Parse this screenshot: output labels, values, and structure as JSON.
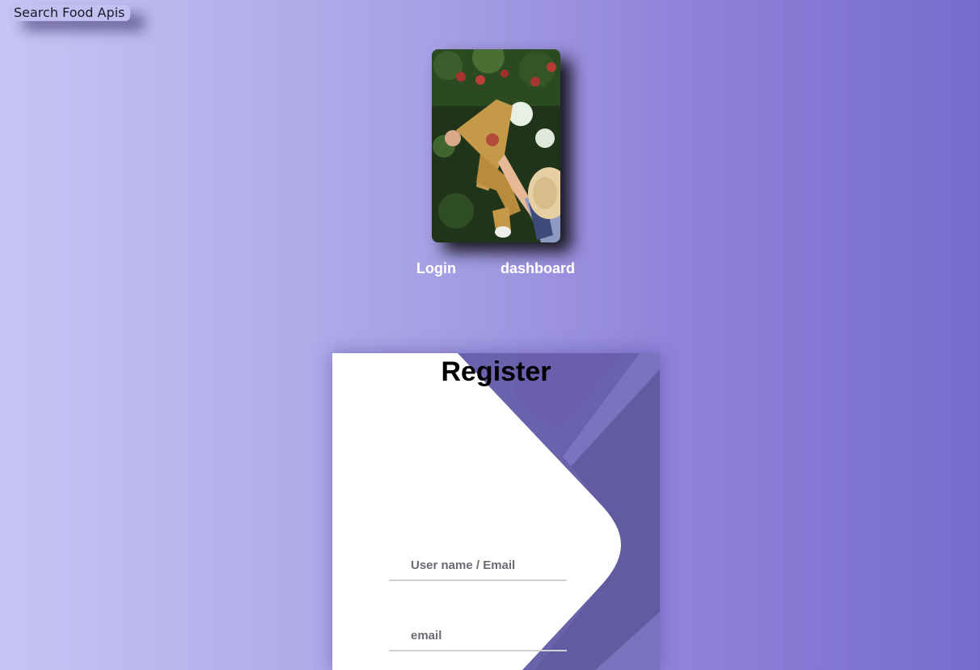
{
  "header": {
    "site_title": "Search Food Apis"
  },
  "hero": {
    "image_alt": "Person picking apples in a tree"
  },
  "nav": {
    "login_label": "Login",
    "dashboard_label": "dashboard"
  },
  "register": {
    "title": "Register",
    "username_placeholder": "User name / Email",
    "email_placeholder": "email"
  },
  "colors": {
    "background_start": "#c7c5f4",
    "background_end": "#776bcc",
    "card_accent": "#5d54a4",
    "card_background": "#ffffff"
  }
}
